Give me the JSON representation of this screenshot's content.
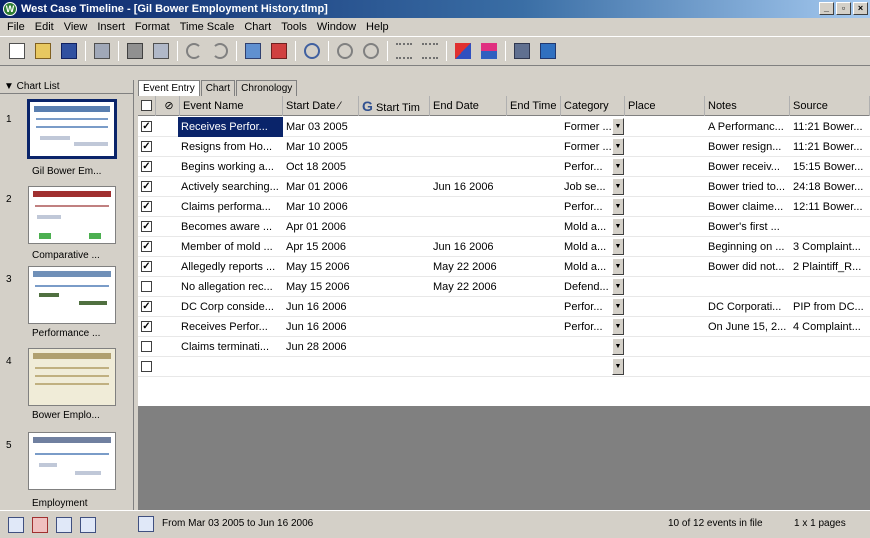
{
  "window": {
    "title": "West Case Timeline - [Gil Bower Employment History.tlmp]",
    "app_icon_letter": "W"
  },
  "menu": [
    "File",
    "Edit",
    "View",
    "Insert",
    "Format",
    "Time Scale",
    "Chart",
    "Tools",
    "Window",
    "Help"
  ],
  "chartlist": {
    "header": "▼ Chart List",
    "items": [
      {
        "num": "1",
        "label": "Gil Bower Em..."
      },
      {
        "num": "2",
        "label": "Comparative ..."
      },
      {
        "num": "3",
        "label": "Performance ..."
      },
      {
        "num": "4",
        "label": "Bower Emplo..."
      },
      {
        "num": "5",
        "label": "Employment"
      }
    ]
  },
  "tabs": [
    "Event Entry",
    "Chart",
    "Chronology"
  ],
  "grid": {
    "columns": [
      "Event Name",
      "Start Date",
      "Start Tim",
      "End Date",
      "End Time",
      "Category",
      "Place",
      "Notes",
      "Source"
    ],
    "rows": [
      {
        "checked": true,
        "name": "Receives Perfor...",
        "start": "Mar 03 2005",
        "end": "",
        "category": "Former ...",
        "notes": "A Performanc...",
        "source": "11:21 Bower..."
      },
      {
        "checked": true,
        "name": "Resigns from Ho...",
        "start": "Mar 10 2005",
        "end": "",
        "category": "Former ...",
        "notes": "Bower resign...",
        "source": "11:21 Bower..."
      },
      {
        "checked": true,
        "name": "Begins working a...",
        "start": "Oct 18 2005",
        "end": "",
        "category": "Perfor...",
        "notes": "Bower receiv...",
        "source": "15:15 Bower..."
      },
      {
        "checked": true,
        "name": "Actively searching...",
        "start": "Mar 01 2006",
        "end": "Jun 16 2006",
        "category": "Job se...",
        "notes": "Bower tried to...",
        "source": "24:18 Bower..."
      },
      {
        "checked": true,
        "name": "Claims performa...",
        "start": "Mar 10 2006",
        "end": "",
        "category": "Perfor...",
        "notes": "Bower claime...",
        "source": "12:11 Bower..."
      },
      {
        "checked": true,
        "name": "Becomes aware ...",
        "start": "Apr 01 2006",
        "end": "",
        "category": "Mold a...",
        "notes": "Bower's first ...",
        "source": ""
      },
      {
        "checked": true,
        "name": "Member of mold ...",
        "start": "Apr 15 2006",
        "end": "Jun 16 2006",
        "category": "Mold a...",
        "notes": "Beginning on ...",
        "source": "3 Complaint..."
      },
      {
        "checked": true,
        "name": "Allegedly reports ...",
        "start": "May 15 2006",
        "end": "May 22 2006",
        "category": "Mold a...",
        "notes": "Bower did not...",
        "source": "2 Plaintiff_R..."
      },
      {
        "checked": false,
        "name": "No allegation rec...",
        "start": "May 15 2006",
        "end": "May 22 2006",
        "category": "Defend...",
        "notes": "",
        "source": ""
      },
      {
        "checked": true,
        "name": "DC Corp conside...",
        "start": "Jun 16 2006",
        "end": "",
        "category": "Perfor...",
        "notes": "DC Corporati...",
        "source": "PIP from DC..."
      },
      {
        "checked": true,
        "name": "Receives Perfor...",
        "start": "Jun 16 2006",
        "end": "",
        "category": "Perfor...",
        "notes": "On June 15, 2...",
        "source": "4 Complaint..."
      },
      {
        "checked": false,
        "name": "Claims terminati...",
        "start": "Jun 28 2006",
        "end": "",
        "category": "",
        "notes": "",
        "source": ""
      },
      {
        "checked": false,
        "name": "",
        "start": "",
        "end": "",
        "category": "",
        "notes": "",
        "source": ""
      }
    ]
  },
  "status": {
    "range": "From Mar 03 2005 to Jun 16 2006",
    "count": "10 of 12 events in file",
    "pages": "1 x 1 pages"
  }
}
